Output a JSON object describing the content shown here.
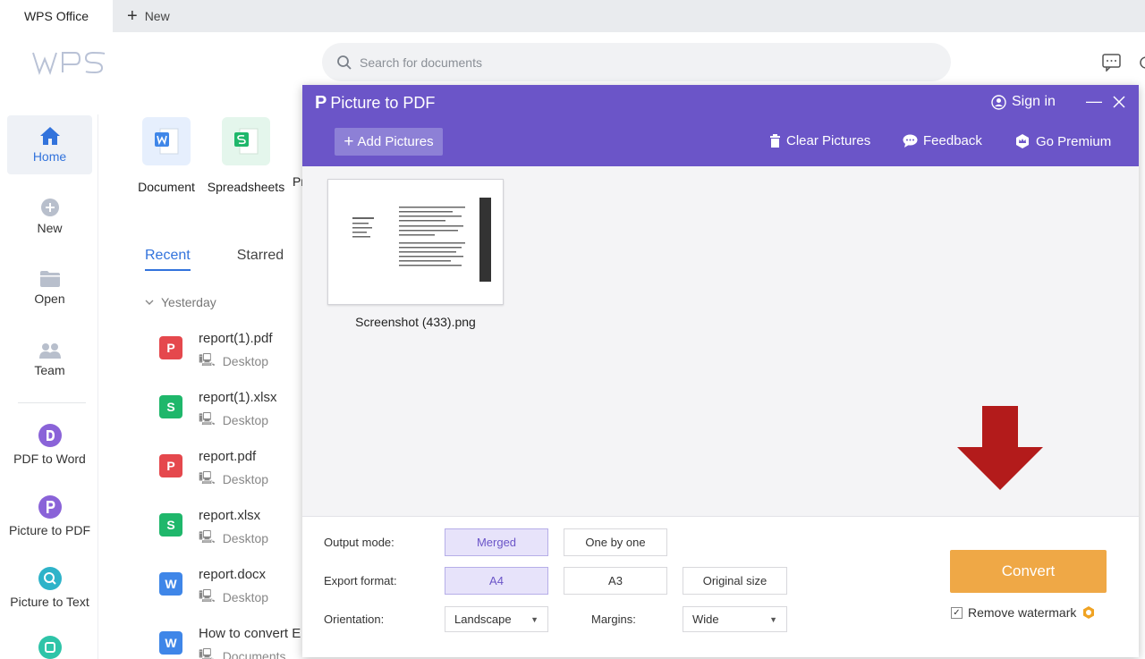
{
  "app": {
    "tab_title": "WPS Office",
    "new_tab_label": "New",
    "logo_text": "WPS"
  },
  "search": {
    "placeholder": "Search for documents"
  },
  "rail": {
    "items": [
      {
        "label": "Home",
        "icon": "home-icon"
      },
      {
        "label": "New",
        "icon": "plus-circle-icon"
      },
      {
        "label": "Open",
        "icon": "folder-icon"
      },
      {
        "label": "Team",
        "icon": "team-icon"
      },
      {
        "label": "PDF to Word",
        "icon": "pdf-to-word-icon"
      },
      {
        "label": "Picture to PDF",
        "icon": "picture-to-pdf-icon"
      },
      {
        "label": "Picture to Text",
        "icon": "picture-to-text-icon"
      }
    ]
  },
  "quick_create": {
    "document": "Document",
    "spreadsheets": "Spreadsheets",
    "presentation": "Pr"
  },
  "tabs": {
    "recent": "Recent",
    "starred": "Starred"
  },
  "recent": {
    "group": "Yesterday",
    "files": [
      {
        "name": "report(1).pdf",
        "location": "Desktop",
        "type": "pdf"
      },
      {
        "name": "report(1).xlsx",
        "location": "Desktop",
        "type": "xlsx"
      },
      {
        "name": "report.pdf",
        "location": "Desktop",
        "type": "pdf"
      },
      {
        "name": "report.xlsx",
        "location": "Desktop",
        "type": "xlsx"
      },
      {
        "name": "report.docx",
        "location": "Desktop",
        "type": "docx"
      },
      {
        "name": "How to convert E",
        "location": "Documents",
        "type": "docx"
      }
    ]
  },
  "dialog": {
    "title": "Picture to PDF",
    "sign_in": "Sign in",
    "add_pictures": "Add Pictures",
    "clear_pictures": "Clear Pictures",
    "feedback": "Feedback",
    "go_premium": "Go Premium",
    "picture_name": "Screenshot (433).png",
    "output_mode_label": "Output mode:",
    "output_mode_options": [
      "Merged",
      "One by one"
    ],
    "output_mode_selected": "Merged",
    "export_format_label": "Export format:",
    "export_format_options": [
      "A4",
      "A3",
      "Original size"
    ],
    "export_format_selected": "A4",
    "orientation_label": "Orientation:",
    "orientation_value": "Landscape",
    "margins_label": "Margins:",
    "margins_value": "Wide",
    "convert_label": "Convert",
    "remove_watermark_label": "Remove watermark",
    "remove_watermark_checked": true
  },
  "colors": {
    "dialog_header": "#6b55c8",
    "convert_button": "#efa846",
    "arrow": "#b31b1b",
    "pdf_icon": "#e5484d",
    "xlsx_icon": "#1fb76b",
    "docx_icon": "#3f86e8",
    "accent": "#3273dc"
  }
}
